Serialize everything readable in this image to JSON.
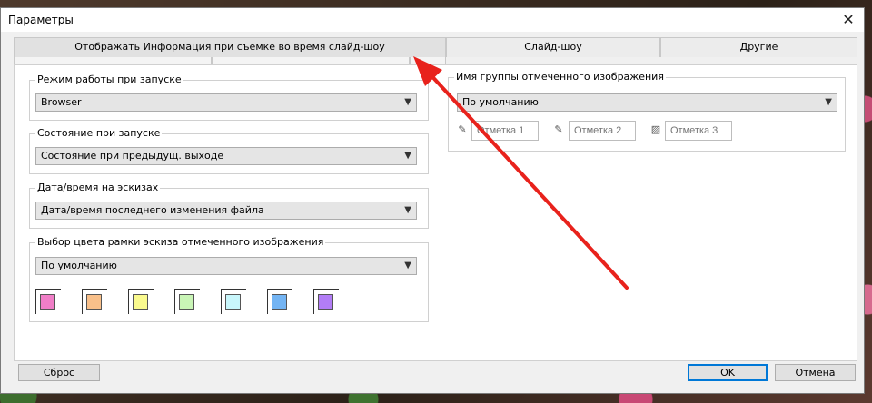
{
  "dialog": {
    "title": "Параметры",
    "close_glyph": "✕"
  },
  "tabs": [
    {
      "label": "Отображать Информация при съемке во время слайд-шоу"
    },
    {
      "label": "Слайд-шоу"
    },
    {
      "label": "Другие"
    }
  ],
  "left_groups": {
    "startup_mode": {
      "label": "Режим работы при запуске",
      "value": "Browser"
    },
    "startup_state": {
      "label": "Состояние при запуске",
      "value": "Состояние при предыдущ. выходе"
    },
    "thumb_datetime": {
      "label": "Дата/время на эскизах",
      "value": "Дата/время последнего изменения файла"
    },
    "frame_color": {
      "label": "Выбор цвета рамки эскиза отмеченного изображения",
      "value": "По умолчанию",
      "swatches": [
        "#f07ec7",
        "#f9c08a",
        "#fafa8e",
        "#c9f5b6",
        "#c8f6fb",
        "#73b4f3",
        "#b27df6"
      ]
    }
  },
  "right_group": {
    "label": "Имя группы отмеченного изображения",
    "value": "По умолчанию",
    "marks": [
      {
        "icon": "mark1-icon",
        "glyph": "✎",
        "placeholder": "Отметка 1"
      },
      {
        "icon": "mark2-icon",
        "glyph": "✎",
        "placeholder": "Отметка 2"
      },
      {
        "icon": "mark3-icon",
        "glyph": "▨",
        "placeholder": "Отметка 3"
      }
    ]
  },
  "footer": {
    "reset": "Сброс",
    "ok": "OK",
    "cancel": "Отмена"
  },
  "annotation": {
    "arrow_color": "#e8221c"
  }
}
